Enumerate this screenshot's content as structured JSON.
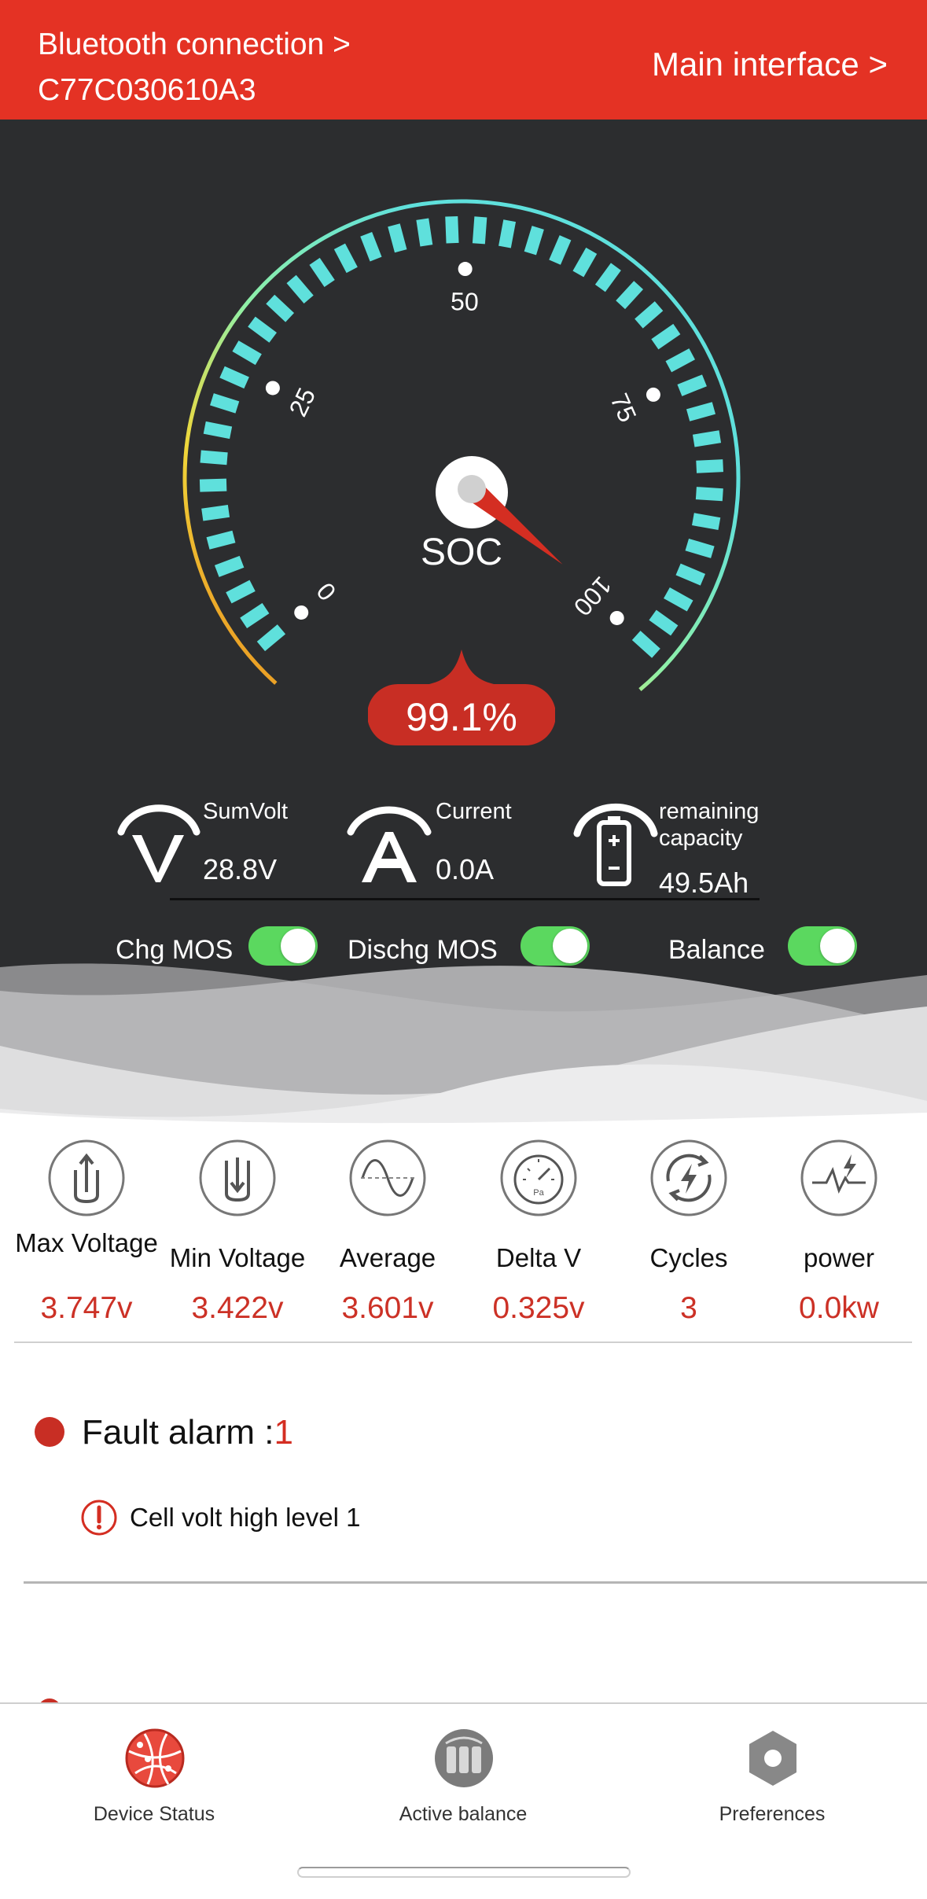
{
  "header": {
    "bluetooth_label": "Bluetooth connection >",
    "device_id": "C77C030610A3",
    "main_interface_label": "Main interface >",
    "background_color": "#e43224"
  },
  "gauge": {
    "center_label": "SOC",
    "ticks": [
      "0",
      "25",
      "50",
      "75",
      "100"
    ],
    "soc_percent": 99.1,
    "soc_display": "99.1%",
    "accent_color": "#5fe0dc",
    "needle_color": "#d42e22"
  },
  "metrics": {
    "sumvolt": {
      "label": "SumVolt",
      "value": "28.8V"
    },
    "current": {
      "label": "Current",
      "value": "0.0A"
    },
    "capacity": {
      "label": "remaining capacity",
      "value": "49.5Ah"
    }
  },
  "toggles": {
    "chg_mos": {
      "label": "Chg MOS",
      "on": true
    },
    "dischg_mos": {
      "label": "Dischg MOS",
      "on": true
    },
    "balance": {
      "label": "Balance",
      "on": true
    }
  },
  "stats": [
    {
      "icon": "max-voltage-icon",
      "label": "Max Voltage",
      "value": "3.747v"
    },
    {
      "icon": "min-voltage-icon",
      "label": "Min Voltage",
      "value": "3.422v"
    },
    {
      "icon": "average-icon",
      "label": "Average",
      "value": "3.601v"
    },
    {
      "icon": "delta-v-icon",
      "label": "Delta V",
      "value": "0.325v"
    },
    {
      "icon": "cycles-icon",
      "label": "Cycles",
      "value": "3"
    },
    {
      "icon": "power-icon",
      "label": "power",
      "value": "0.0kw"
    }
  ],
  "fault": {
    "title": "Fault alarm :",
    "count": "1",
    "alarms": [
      {
        "icon": "alert-icon",
        "text": "Cell volt high level 1"
      }
    ]
  },
  "tabs": [
    {
      "icon": "device-status-icon",
      "label": "Device Status",
      "active": true
    },
    {
      "icon": "active-balance-icon",
      "label": "Active balance",
      "active": false
    },
    {
      "icon": "preferences-icon",
      "label": "Preferences",
      "active": false
    }
  ]
}
